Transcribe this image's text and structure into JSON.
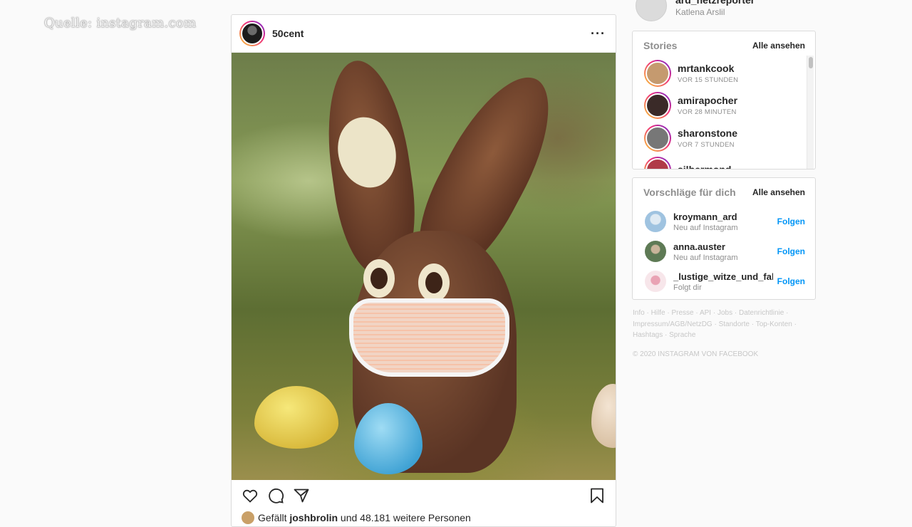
{
  "overlay": {
    "source": "Quelle: instagram.com"
  },
  "post": {
    "username": "50cent",
    "likes_prefix": "Gefällt",
    "liked_by": "joshbrolin",
    "likes_suffix": "und 48.181 weitere Personen"
  },
  "me": {
    "username": "ard_netzreporter",
    "full_name": "Katlena Arslil"
  },
  "stories": {
    "title": "Stories",
    "see_all": "Alle ansehen",
    "items": [
      {
        "user": "mrtankcook",
        "time": "VOR 15 STUNDEN",
        "color": "#c59a6f"
      },
      {
        "user": "amirapocher",
        "time": "VOR 28 MINUTEN",
        "color": "#3a2a28"
      },
      {
        "user": "sharonstone",
        "time": "VOR 7 STUNDEN",
        "color": "#777777"
      },
      {
        "user": "silbermond",
        "time": "",
        "color": "#b03a48"
      }
    ]
  },
  "suggestions": {
    "title": "Vorschläge für dich",
    "see_all": "Alle ansehen",
    "follow_label": "Folgen",
    "items": [
      {
        "user": "kroymann_ard",
        "sub": "Neu auf Instagram",
        "color": "#9fc3e0"
      },
      {
        "user": "anna.auster",
        "sub": "Neu auf Instagram",
        "color": "#5e7a55"
      },
      {
        "user": "_lustige_witze_und_fakten",
        "sub": "Folgt dir",
        "color": "#f2d5dc"
      }
    ]
  },
  "footer": {
    "links": [
      "Info",
      "Hilfe",
      "Presse",
      "API",
      "Jobs",
      "Datenrichtlinie",
      "Impressum/AGB/NetzDG",
      "Standorte",
      "Top-Konten",
      "Hashtags",
      "Sprache"
    ],
    "copyright": "© 2020 INSTAGRAM VON FACEBOOK"
  },
  "icons": [
    "heart-icon",
    "comment-icon",
    "share-icon",
    "bookmark-icon",
    "more-icon"
  ]
}
